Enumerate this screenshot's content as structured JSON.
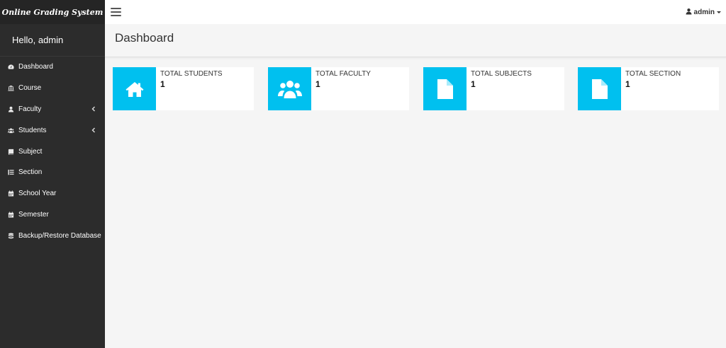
{
  "sidebar": {
    "brand": "Online Grading System",
    "greeting": "Hello, admin",
    "items": [
      {
        "label": "Dashboard",
        "icon": "dashboard-icon"
      },
      {
        "label": "Course",
        "icon": "institution-icon"
      },
      {
        "label": "Faculty",
        "icon": "user-icon"
      },
      {
        "label": "Students",
        "icon": "users-icon"
      },
      {
        "label": "Subject",
        "icon": "book-icon"
      },
      {
        "label": "Section",
        "icon": "list-icon"
      },
      {
        "label": "School Year",
        "icon": "calendar-icon"
      },
      {
        "label": "Semester",
        "icon": "calendar-icon"
      },
      {
        "label": "Backup/Restore Database",
        "icon": "database-icon"
      }
    ]
  },
  "topbar": {
    "user_label": "admin"
  },
  "header": {
    "title": "Dashboard"
  },
  "stats": [
    {
      "label": "TOTAL STUDENTS",
      "value": "1",
      "icon": "home-icon"
    },
    {
      "label": "TOTAL FACULTY",
      "value": "1",
      "icon": "users-icon"
    },
    {
      "label": "TOTAL SUBJECTS",
      "value": "1",
      "icon": "file-icon"
    },
    {
      "label": "TOTAL SECTION",
      "value": "1",
      "icon": "file-icon"
    }
  ],
  "colors": {
    "sidebar_bg": "#2c2c2c",
    "accent": "#00c0ef",
    "content_bg": "#f5f5f5"
  }
}
